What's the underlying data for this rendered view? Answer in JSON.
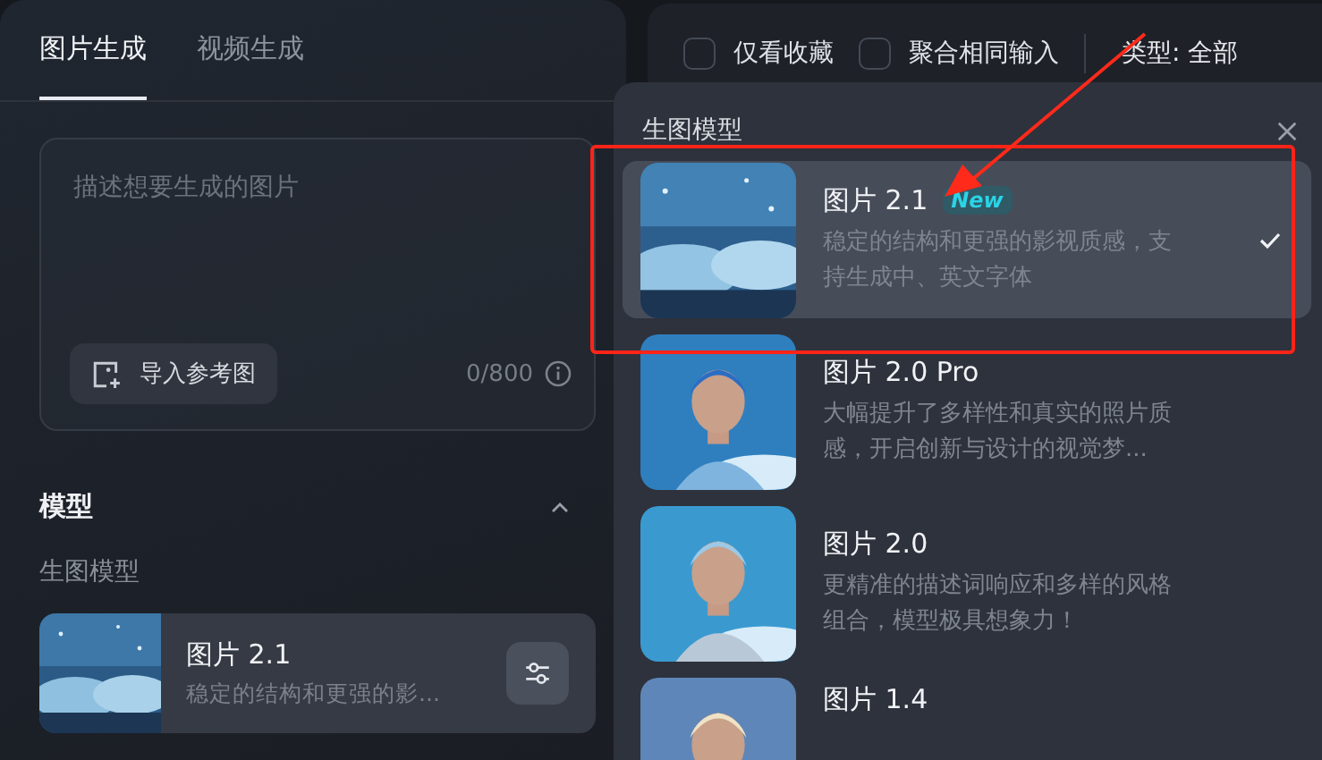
{
  "tabs": [
    {
      "label": "图片生成",
      "selected": true
    },
    {
      "label": "视频生成",
      "selected": false
    }
  ],
  "prompt": {
    "placeholder": "描述想要生成的图片",
    "upload_button": "导入参考图",
    "counter": "0/800"
  },
  "model_section": {
    "title": "模型",
    "expanded": true,
    "subtitle": "生图模型",
    "current": {
      "name": "图片 2.1",
      "description": "稳定的结构和更强的影..."
    }
  },
  "filters": [
    {
      "label": "仅看收藏",
      "checked": false
    },
    {
      "label": "聚合相同输入",
      "checked": false
    }
  ],
  "type_filter": "类型: 全部",
  "dropdown": {
    "title": "生图模型",
    "models": [
      {
        "name": "图片 2.1",
        "badge": "New",
        "description": "稳定的结构和更强的影视质感，支持生成中、英文字体",
        "selected": true
      },
      {
        "name": "图片 2.0 Pro",
        "description": "大幅提升了多样性和真实的照片质感，开启创新与设计的视觉梦...",
        "selected": false
      },
      {
        "name": "图片 2.0",
        "description": "更精准的描述词响应和多样的风格组合，模型极具想象力！",
        "selected": false
      },
      {
        "name": "图片 1.4",
        "selected": false
      }
    ]
  }
}
